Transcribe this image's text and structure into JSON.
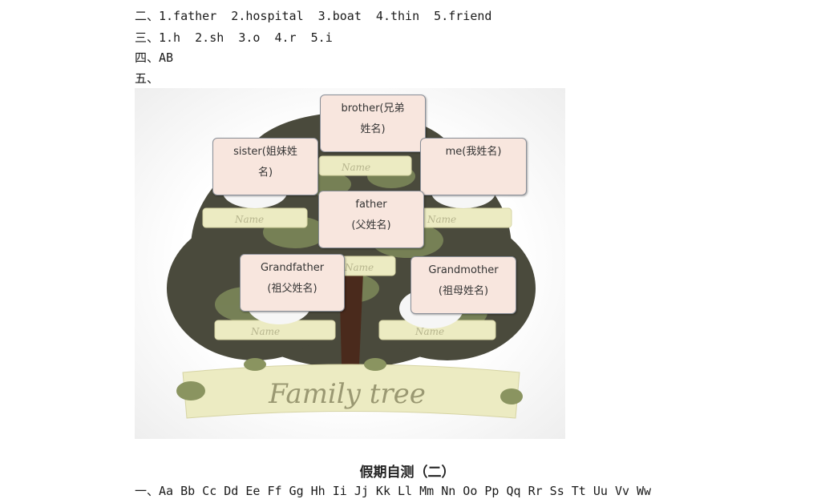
{
  "answers": {
    "section2": "二、1.father  2.hospital  3.boat  4.thin  5.friend",
    "section3": "三、1.h  2.sh  3.o  4.r  5.i",
    "section4": "四、AB",
    "section5": "五、"
  },
  "family_tree": {
    "banner": "Family tree",
    "ribbon_label": "Name",
    "boxes": {
      "brother": "brother(兄弟\n姓名)",
      "sister": "sister(姐妹姓\n名)",
      "me": "me(我姓名)",
      "father": "father\n(父姓名)",
      "grandfather": "Grandfather\n(祖父姓名)",
      "grandmother": "Grandmother\n(祖母姓名)"
    }
  },
  "section_title": "假期自测（二）",
  "alphabet_line": "一、Aa Bb Cc Dd Ee Ff Gg Hh Ii Jj Kk Ll Mm Nn Oo Pp Qq Rr Ss Tt Uu Vv Ww"
}
